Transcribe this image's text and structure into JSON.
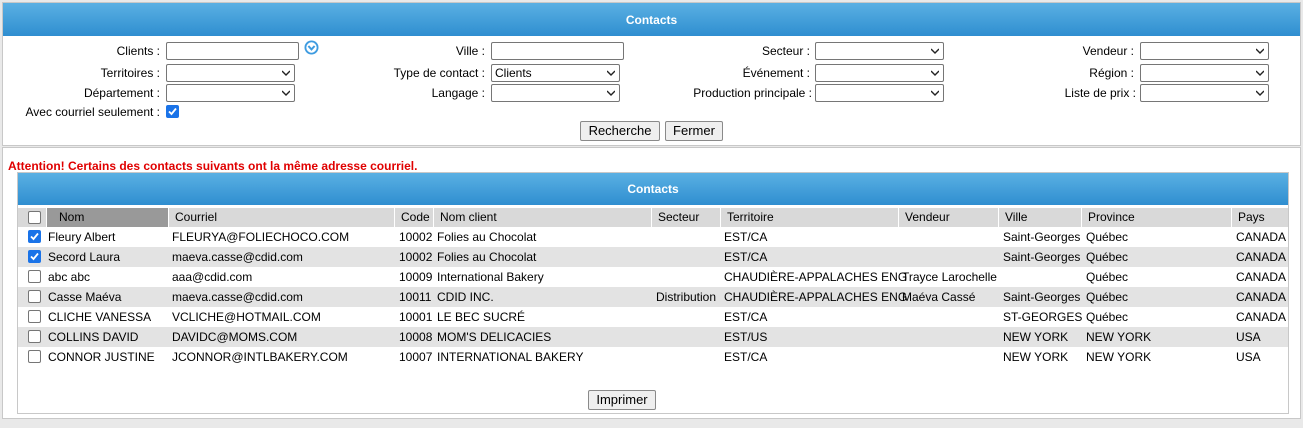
{
  "header": {
    "title": "Contacts"
  },
  "filters": {
    "clients": {
      "label": "Clients :",
      "value": ""
    },
    "ville": {
      "label": "Ville :",
      "value": ""
    },
    "secteur": {
      "label": "Secteur :",
      "value": ""
    },
    "vendeur": {
      "label": "Vendeur :",
      "value": ""
    },
    "territoires": {
      "label": "Territoires :",
      "value": ""
    },
    "type_contact": {
      "label": "Type de contact :",
      "value": "Clients"
    },
    "evenement": {
      "label": "Événement :",
      "value": ""
    },
    "region": {
      "label": "Région :",
      "value": ""
    },
    "departement": {
      "label": "Département :",
      "value": ""
    },
    "langage": {
      "label": "Langage :",
      "value": ""
    },
    "production": {
      "label": "Production principale :",
      "value": ""
    },
    "liste_prix": {
      "label": "Liste de prix :",
      "value": ""
    },
    "courriel_seulement": {
      "label": "Avec courriel seulement :",
      "checked": true
    }
  },
  "buttons": {
    "search": "Recherche",
    "close": "Fermer",
    "print": "Imprimer"
  },
  "warning": "Attention! Certains des contacts suivants ont la même adresse courriel.",
  "table": {
    "title": "Contacts",
    "columns": {
      "nom": "Nom",
      "courriel": "Courriel",
      "code": "Code",
      "client": "Nom client",
      "secteur": "Secteur",
      "territoire": "Territoire",
      "vendeur": "Vendeur",
      "ville": "Ville",
      "province": "Province",
      "pays": "Pays"
    },
    "rows": [
      {
        "checked": true,
        "nom": "Fleury Albert",
        "courriel": "FLEURYA@FOLIECHOCO.COM",
        "code": "10002",
        "client": "Folies au Chocolat",
        "secteur": "",
        "territoire": "EST/CA",
        "vendeur": "",
        "ville": "Saint-Georges",
        "province": "Québec",
        "pays": "CANADA"
      },
      {
        "checked": true,
        "nom": "Secord Laura",
        "courriel": "maeva.casse@cdid.com",
        "code": "10002",
        "client": "Folies au Chocolat",
        "secteur": "",
        "territoire": "EST/CA",
        "vendeur": "",
        "ville": "Saint-Georges",
        "province": "Québec",
        "pays": "CANADA"
      },
      {
        "checked": false,
        "nom": "abc abc",
        "courriel": "aaa@cdid.com",
        "code": "10009",
        "client": "International Bakery",
        "secteur": "",
        "territoire": "CHAUDIÈRE-APPALACHES ENG",
        "vendeur": "Trayce Larochelle",
        "ville": "",
        "province": "Québec",
        "pays": "CANADA"
      },
      {
        "checked": false,
        "nom": "Casse Maéva",
        "courriel": "maeva.casse@cdid.com",
        "code": "10011",
        "client": "CDID INC.",
        "secteur": "Distribution",
        "territoire": "CHAUDIÈRE-APPALACHES ENG",
        "vendeur": "Maéva Cassé",
        "ville": "Saint-Georges",
        "province": "Québec",
        "pays": "CANADA"
      },
      {
        "checked": false,
        "nom": "CLICHE VANESSA",
        "courriel": "VCLICHE@HOTMAIL.COM",
        "code": "10001",
        "client": "LE BEC SUCRÉ",
        "secteur": "",
        "territoire": "EST/CA",
        "vendeur": "",
        "ville": "ST-GEORGES",
        "province": "Québec",
        "pays": "CANADA"
      },
      {
        "checked": false,
        "nom": "COLLINS DAVID",
        "courriel": "DAVIDC@MOMS.COM",
        "code": "10008",
        "client": "MOM'S DELICACIES",
        "secteur": "",
        "territoire": "EST/US",
        "vendeur": "",
        "ville": "NEW YORK",
        "province": "NEW YORK",
        "pays": "USA"
      },
      {
        "checked": false,
        "nom": "CONNOR JUSTINE",
        "courriel": "JCONNOR@INTLBAKERY.COM",
        "code": "10007",
        "client": "INTERNATIONAL BAKERY",
        "secteur": "",
        "territoire": "EST/CA",
        "vendeur": "",
        "ville": "NEW YORK",
        "province": "NEW YORK",
        "pays": "USA"
      }
    ]
  },
  "colors": {
    "title_bar": "#3b9ad8",
    "warning": "#e00000",
    "checkbox_on": "#1a73e8"
  },
  "icons": {
    "clients_lookup": "chevron-down-circle-icon"
  }
}
